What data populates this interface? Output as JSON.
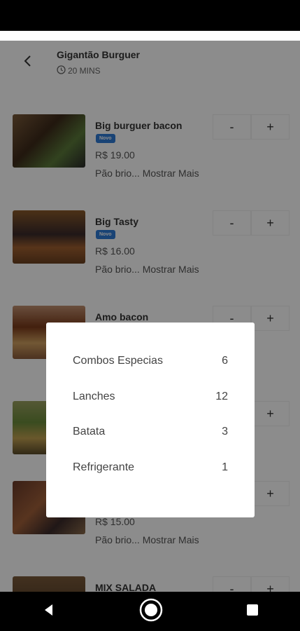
{
  "header": {
    "title": "Gigantão Burguer",
    "time": "20 MINS"
  },
  "items": [
    {
      "name": "Big burguer bacon",
      "badge": "Novo",
      "price": "R$ 19.00",
      "desc": "Pão brio... Mostrar Mais"
    },
    {
      "name": "Big Tasty",
      "badge": "Novo",
      "price": "R$ 16.00",
      "desc": "Pão brio... Mostrar Mais"
    },
    {
      "name": "Amo bacon",
      "badge": "",
      "price": "",
      "desc": ""
    },
    {
      "name": "",
      "badge": "",
      "price": "",
      "desc": ""
    },
    {
      "name": "",
      "badge": "",
      "price": "R$ 15.00",
      "desc": "Pão brio... Mostrar Mais"
    },
    {
      "name": "MIX SALADA",
      "badge": "",
      "price": "",
      "desc": ""
    }
  ],
  "stepper": {
    "minus": "-",
    "plus": "+"
  },
  "categories": [
    {
      "label": "Combos Especias",
      "count": "6"
    },
    {
      "label": "Lanches",
      "count": "12"
    },
    {
      "label": "Batata",
      "count": "3"
    },
    {
      "label": "Refrigerante",
      "count": "1"
    }
  ],
  "colors": {
    "badge": "#2e7bd6",
    "overlay": "rgba(0,0,0,0.45)"
  }
}
